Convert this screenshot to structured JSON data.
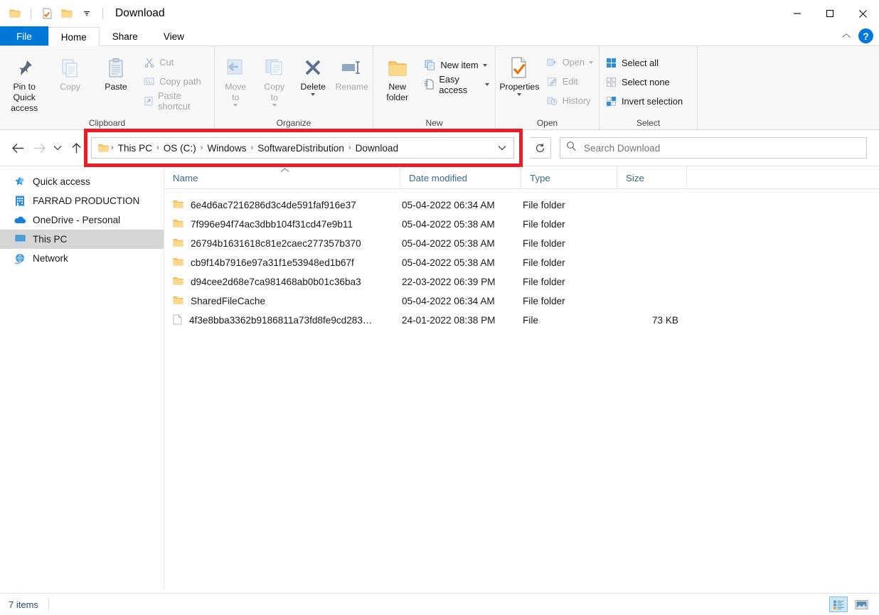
{
  "window": {
    "title": "Download",
    "quick_access": [
      {
        "name": "folder-icon",
        "label": "Folder"
      },
      {
        "name": "properties-icon",
        "label": "Properties"
      },
      {
        "name": "new-folder-icon",
        "label": "New folder"
      },
      {
        "name": "customize-qat-icon",
        "label": "Customize Quick Access Toolbar"
      }
    ],
    "controls": {
      "minimize": "Minimize",
      "maximize": "Maximize",
      "close": "Close"
    }
  },
  "ribbon": {
    "tabs": [
      {
        "label": "File",
        "type": "file"
      },
      {
        "label": "Home",
        "type": "active"
      },
      {
        "label": "Share",
        "type": "normal"
      },
      {
        "label": "View",
        "type": "normal"
      }
    ],
    "collapse_label": "Minimize the Ribbon",
    "help_label": "?",
    "groups": [
      {
        "label": "Clipboard",
        "big": [
          {
            "label": "Pin to Quick\naccess",
            "icon": "pin-icon",
            "dim": false
          },
          {
            "label": "Copy",
            "icon": "copy-icon",
            "dim": true
          },
          {
            "label": "Paste",
            "icon": "paste-icon",
            "dim": false
          }
        ],
        "small": [
          {
            "label": "Cut",
            "icon": "cut-icon",
            "dim": true
          },
          {
            "label": "Copy path",
            "icon": "copy-path-icon",
            "dim": true
          },
          {
            "label": "Paste shortcut",
            "icon": "paste-shortcut-icon",
            "dim": true
          }
        ]
      },
      {
        "label": "Organize",
        "big": [
          {
            "label": "Move\nto",
            "icon": "move-to-icon",
            "dim": true,
            "caret": true
          },
          {
            "label": "Copy\nto",
            "icon": "copy-to-icon",
            "dim": true,
            "caret": true
          },
          {
            "label": "Delete",
            "icon": "delete-icon",
            "dim": false,
            "caret": true
          },
          {
            "label": "Rename",
            "icon": "rename-icon",
            "dim": true
          }
        ],
        "small": []
      },
      {
        "label": "New",
        "big": [
          {
            "label": "New\nfolder",
            "icon": "new-folder-icon",
            "dim": false
          }
        ],
        "small": [
          {
            "label": "New item",
            "icon": "new-item-icon",
            "dim": false,
            "caret": true
          },
          {
            "label": "Easy access",
            "icon": "easy-access-icon",
            "dim": false,
            "caret": true
          }
        ]
      },
      {
        "label": "Open",
        "big": [
          {
            "label": "Properties",
            "icon": "properties-icon",
            "dim": false,
            "caret": true
          }
        ],
        "small": [
          {
            "label": "Open",
            "icon": "open-icon",
            "dim": true,
            "caret": true
          },
          {
            "label": "Edit",
            "icon": "edit-icon",
            "dim": true
          },
          {
            "label": "History",
            "icon": "history-icon",
            "dim": true
          }
        ]
      },
      {
        "label": "Select",
        "big": [],
        "small": [
          {
            "label": "Select all",
            "icon": "select-all-icon",
            "dim": false
          },
          {
            "label": "Select none",
            "icon": "select-none-icon",
            "dim": false
          },
          {
            "label": "Invert selection",
            "icon": "invert-selection-icon",
            "dim": false
          }
        ]
      }
    ]
  },
  "navigation": {
    "back_label": "Back",
    "forward_label": "Forward",
    "recent_label": "Recent locations",
    "up_label": "Up one level",
    "refresh_label": "Refresh",
    "breadcrumbs": [
      "This PC",
      "OS (C:)",
      "Windows",
      "SoftwareDistribution",
      "Download"
    ],
    "separator": "›",
    "highlight_color": "#ed1c24"
  },
  "search": {
    "placeholder": "Search Download",
    "value": ""
  },
  "sidebar": {
    "items": [
      {
        "label": "Quick access",
        "icon": "star-pin-icon",
        "selected": false
      },
      {
        "label": "FARRAD PRODUCTION",
        "icon": "organization-icon",
        "selected": false
      },
      {
        "label": "OneDrive - Personal",
        "icon": "onedrive-cloud-icon",
        "selected": false
      },
      {
        "label": "This PC",
        "icon": "this-pc-icon",
        "selected": true
      },
      {
        "label": "Network",
        "icon": "network-icon",
        "selected": false
      }
    ]
  },
  "file_list": {
    "columns": [
      "Name",
      "Date modified",
      "Type",
      "Size"
    ],
    "sort_column": "Name",
    "sort_direction": "ascending",
    "rows": [
      {
        "name": "6e4d6ac7216286d3c4de591faf916e37",
        "date": "05-04-2022 06:34 AM",
        "type": "File folder",
        "size": "",
        "icon": "folder-icon"
      },
      {
        "name": "7f996e94f74ac3dbb104f31cd47e9b11",
        "date": "05-04-2022 05:38 AM",
        "type": "File folder",
        "size": "",
        "icon": "folder-icon"
      },
      {
        "name": "26794b1631618c81e2caec277357b370",
        "date": "05-04-2022 05:38 AM",
        "type": "File folder",
        "size": "",
        "icon": "folder-icon"
      },
      {
        "name": "cb9f14b7916e97a31f1e53948ed1b67f",
        "date": "05-04-2022 05:38 AM",
        "type": "File folder",
        "size": "",
        "icon": "folder-icon"
      },
      {
        "name": "d94cee2d68e7ca981468ab0b01c36ba3",
        "date": "22-03-2022 06:39 PM",
        "type": "File folder",
        "size": "",
        "icon": "folder-icon"
      },
      {
        "name": "SharedFileCache",
        "date": "05-04-2022 06:34 AM",
        "type": "File folder",
        "size": "",
        "icon": "folder-icon"
      },
      {
        "name": "4f3e8bba3362b9186811a73fd8fe9cd283…",
        "date": "24-01-2022 08:38 PM",
        "type": "File",
        "size": "73 KB",
        "icon": "file-icon"
      }
    ]
  },
  "status": {
    "item_count": "7 items",
    "views": [
      {
        "name": "details-view-button",
        "label": "Details view",
        "active": true
      },
      {
        "name": "large-icons-view-button",
        "label": "Large icons view",
        "active": false
      }
    ]
  }
}
